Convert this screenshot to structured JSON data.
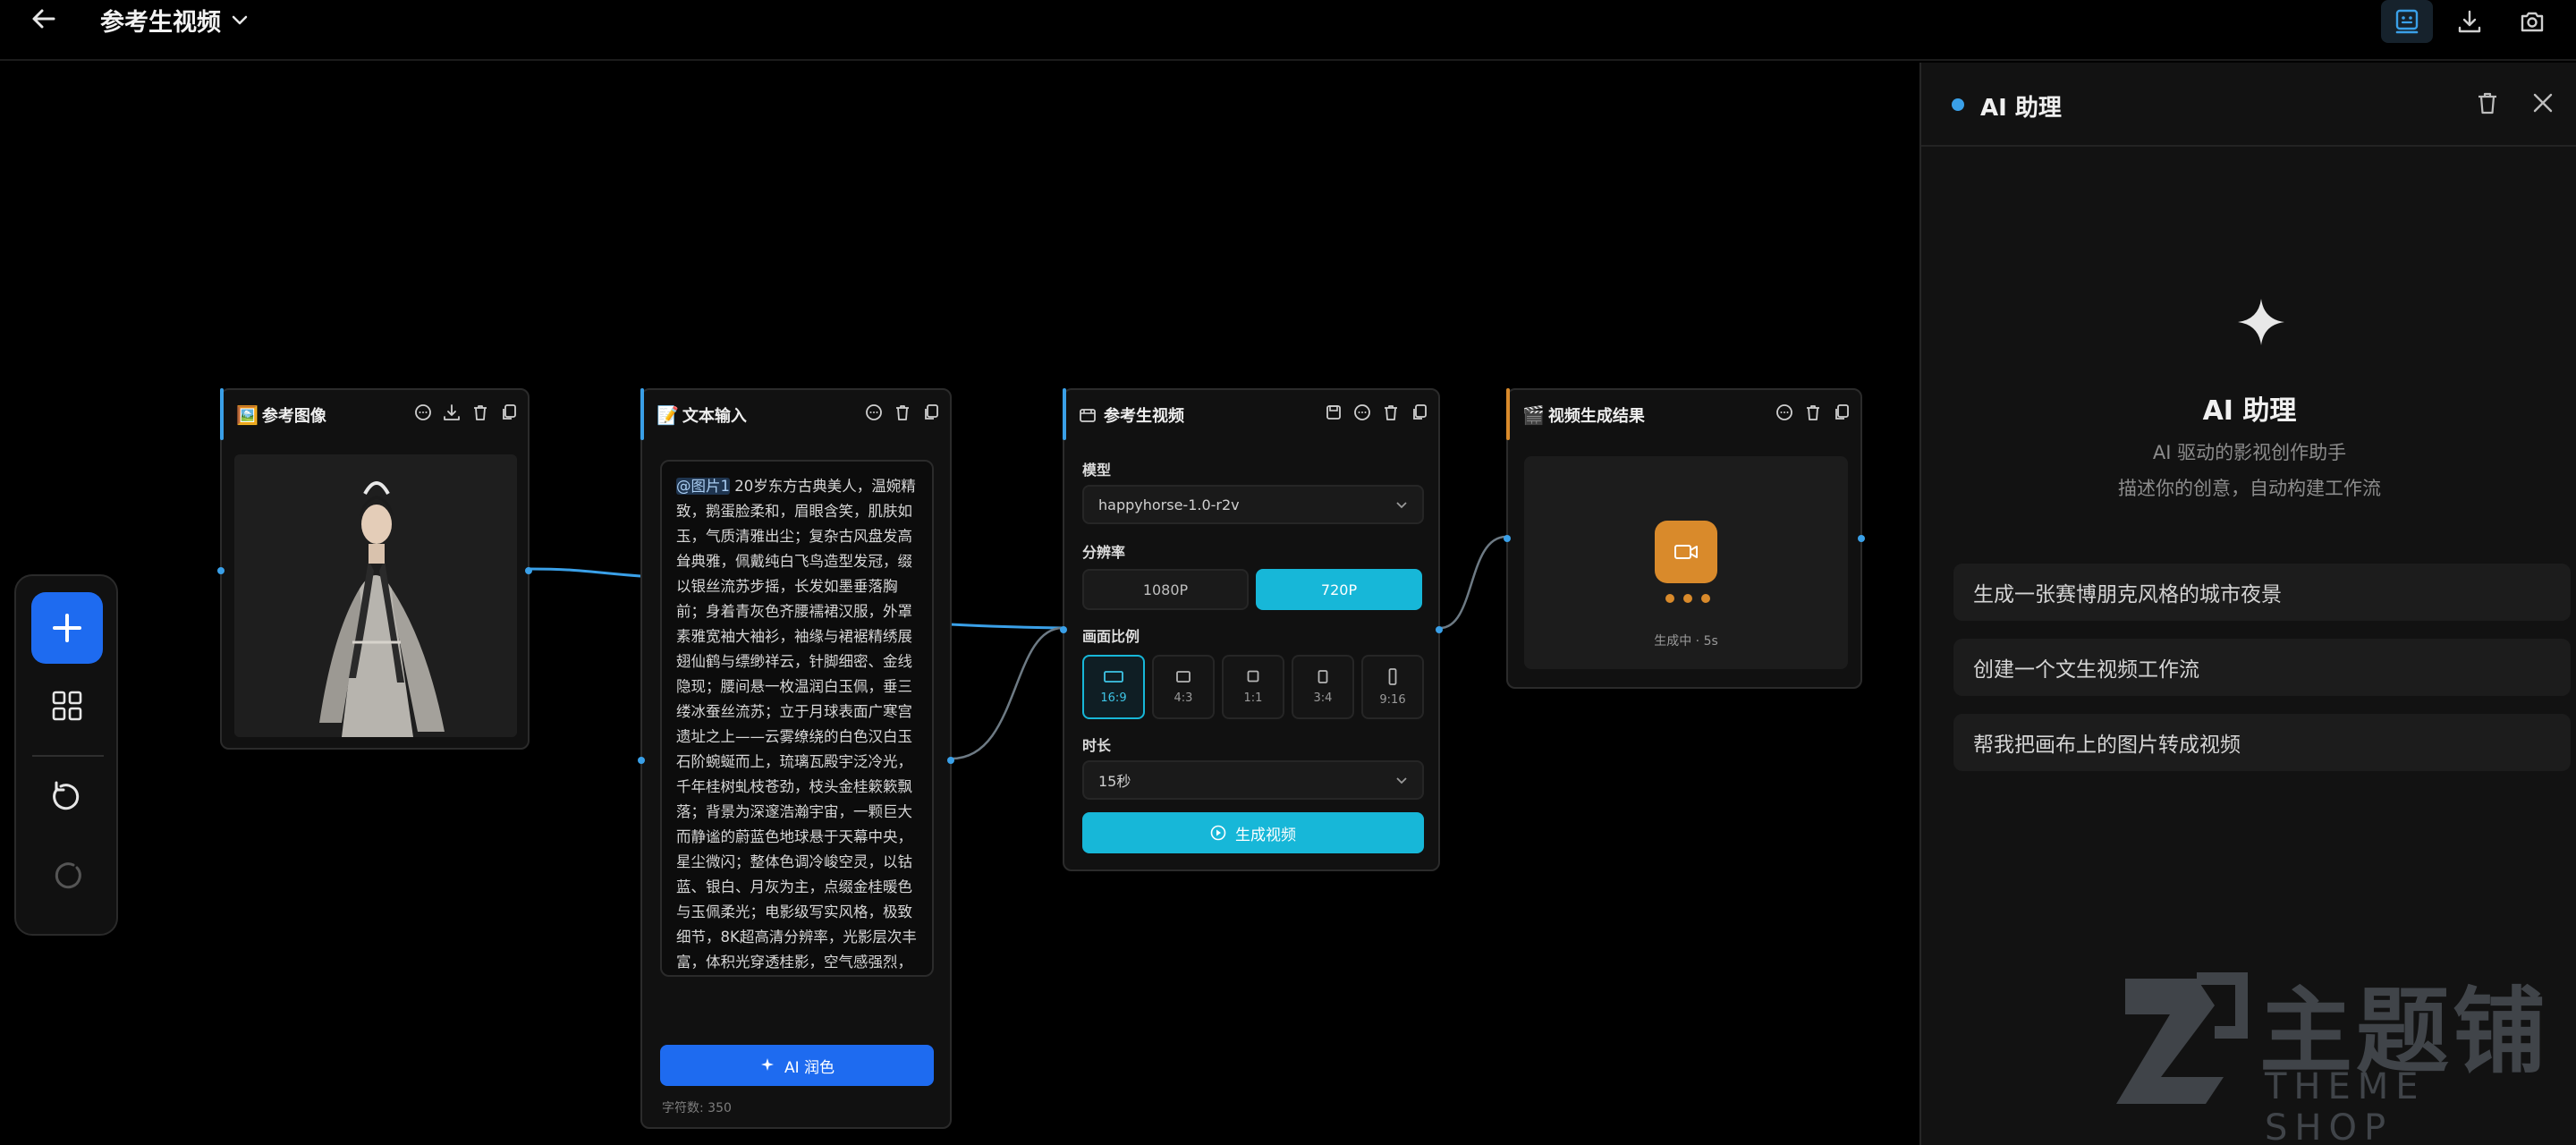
{
  "header": {
    "title": "参考生视频"
  },
  "nodes": {
    "image": {
      "title": "参考图像",
      "emoji": "🖼️",
      "accent_color": "#3aa0e8"
    },
    "text": {
      "title": "文本输入",
      "emoji": "📝",
      "accent_color": "#3aa0e8",
      "mention": "@图片1",
      "content": " 20岁东方古典美人，温婉精致，鹅蛋脸柔和，眉眼含笑，肌肤如玉，气质清雅出尘；复杂古风盘发高耸典雅，佩戴纯白飞鸟造型发冠，缀以银丝流苏步摇，长发如墨垂落胸前；身着青灰色齐腰襦裙汉服，外罩素雅宽袖大袖衫，袖缘与裙裾精绣展翅仙鹤与缥缈祥云，针脚细密、金线隐现；腰间悬一枚温润白玉佩，垂三缕冰蚕丝流苏；立于月球表面广寒宫遗址之上——云雾缭绕的白色汉白玉石阶蜿蜒而上，琉璃瓦殿宇泛冷光，千年桂树虬枝苍劲，枝头金桂簌簌飘落；背景为深邃浩瀚宇宙，一颗巨大而静谧的蔚蓝色地球悬于天幕中央，星尘微闪；整体色调冷峻空灵，以钴蓝、银白、月灰为主，点缀金桂暖色与玉佩柔光；电影级写实风格，极致细节，8K超高清分辨率，光影层次丰富，体积光穿透桂影，空气感强烈，虚实相生，东方神话意境与太空诗学交融，新中式科幻美学巅峰",
      "ai_polish_label": "AI 润色",
      "char_count": "字符数: 350"
    },
    "video": {
      "title": "参考生视频",
      "accent_color": "#3aa0e8",
      "model_label": "模型",
      "model_value": "happyhorse-1.0-r2v",
      "resolution_label": "分辨率",
      "resolutions": [
        "1080P",
        "720P"
      ],
      "selected_resolution": "720P",
      "ratio_label": "画面比例",
      "ratios": [
        "16:9",
        "4:3",
        "1:1",
        "3:4",
        "9:16"
      ],
      "selected_ratio": "16:9",
      "duration_label": "时长",
      "duration_value": "15秒",
      "generate_label": "生成视频",
      "brand_color": "#17b7d8"
    },
    "result": {
      "title": "视频生成结果",
      "emoji": "🎬",
      "accent_color": "#d98a2b",
      "status": "生成中 · 5s"
    }
  },
  "assistant": {
    "title": "AI 助理",
    "welcome_title": "AI 助理",
    "subtitle1": "AI 驱动的影视创作助手",
    "subtitle2": "描述你的创意，自动构建工作流",
    "suggestions": [
      "生成一张赛博朋克风格的城市夜景",
      "创建一个文生视频工作流",
      "帮我把画布上的图片转成视频"
    ]
  },
  "watermark": {
    "big": "主题铺",
    "small": "THEME SHOP"
  }
}
